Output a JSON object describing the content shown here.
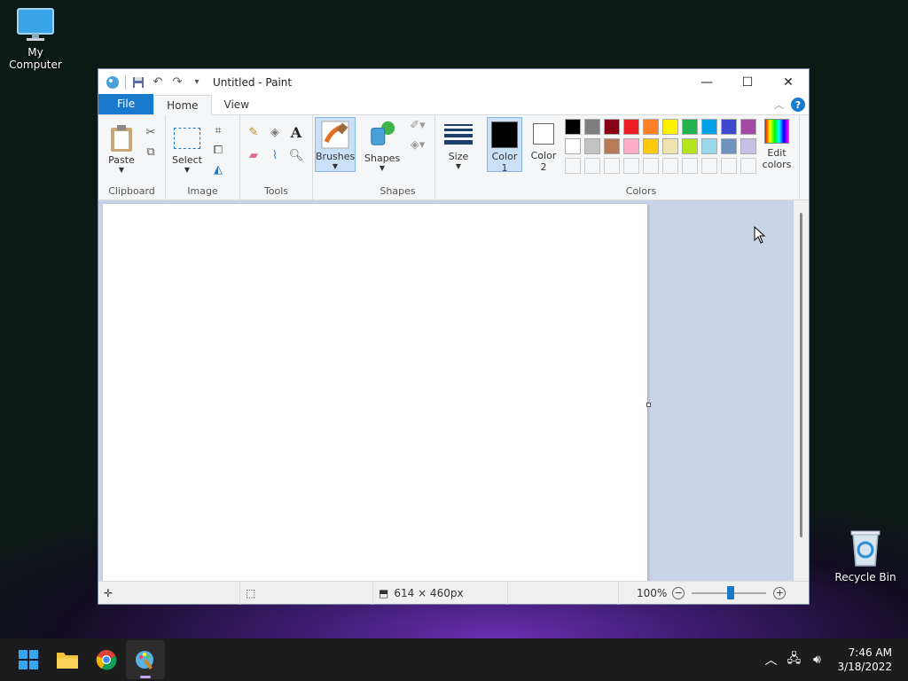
{
  "desktop": {
    "my_computer": "My Computer",
    "recycle_bin": "Recycle Bin"
  },
  "window": {
    "title": "Untitled - Paint",
    "minimize": "—",
    "maximize": "☐",
    "close": "✕"
  },
  "tabs": {
    "file": "File",
    "home": "Home",
    "view": "View"
  },
  "ribbon": {
    "clipboard": {
      "paste": "Paste",
      "group": "Clipboard"
    },
    "image": {
      "select": "Select",
      "group": "Image"
    },
    "tools": {
      "group": "Tools"
    },
    "brushes": {
      "label": "Brushes"
    },
    "shapes": {
      "label": "Shapes",
      "group": "Shapes"
    },
    "size": {
      "label": "Size"
    },
    "colors": {
      "color1": "Color",
      "color1_num": "1",
      "color2": "Color",
      "color2_num": "2",
      "edit_line1": "Edit",
      "edit_line2": "colors",
      "group": "Colors",
      "color1_value": "#000000",
      "color2_value": "#ffffff",
      "palette": [
        "#000000",
        "#7f7f7f",
        "#880015",
        "#ed1c24",
        "#ff7f27",
        "#fff200",
        "#22b14c",
        "#00a2e8",
        "#3f48cc",
        "#a349a4",
        "#ffffff",
        "#c3c3c3",
        "#b97a57",
        "#ffaec9",
        "#ffc90e",
        "#efe4b0",
        "#b5e61d",
        "#99d9ea",
        "#7092be",
        "#c8bfe7",
        "#f5f6f7",
        "#f5f6f7",
        "#f5f6f7",
        "#f5f6f7",
        "#f5f6f7",
        "#f5f6f7",
        "#f5f6f7",
        "#f5f6f7",
        "#f5f6f7",
        "#f5f6f7"
      ]
    }
  },
  "status": {
    "dimensions": "614 × 460px",
    "zoom": "100%"
  },
  "taskbar": {
    "time": "7:46 AM",
    "date": "3/18/2022"
  }
}
